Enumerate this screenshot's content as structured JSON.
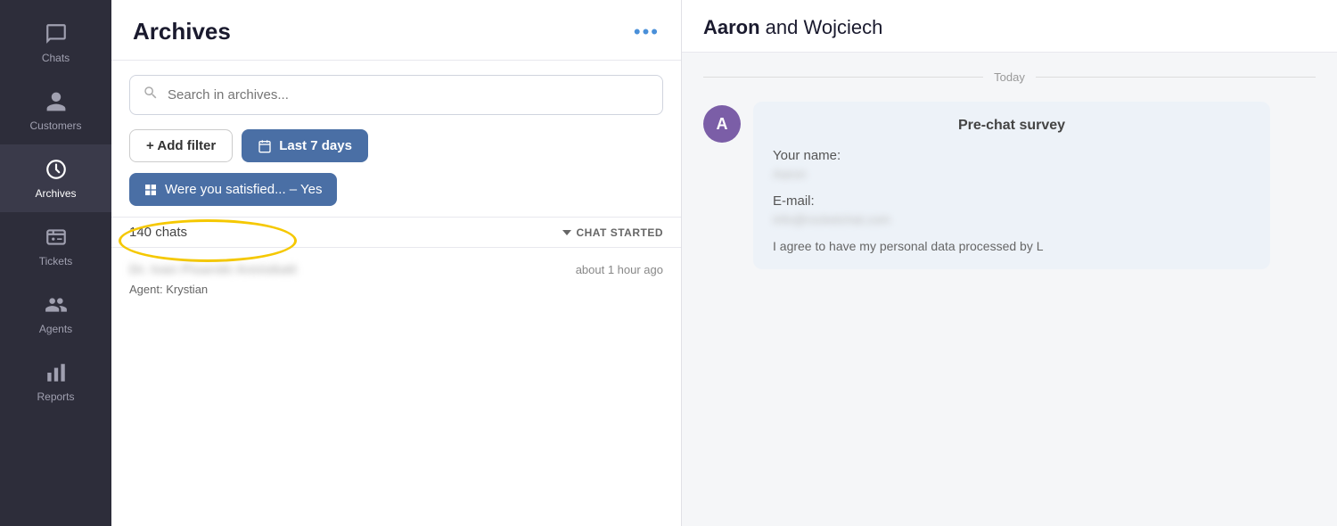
{
  "sidebar": {
    "items": [
      {
        "id": "chats",
        "label": "Chats",
        "icon": "chat-icon",
        "active": false
      },
      {
        "id": "customers",
        "label": "Customers",
        "icon": "customers-icon",
        "active": false
      },
      {
        "id": "archives",
        "label": "Archives",
        "icon": "archives-icon",
        "active": true
      },
      {
        "id": "tickets",
        "label": "Tickets",
        "icon": "tickets-icon",
        "active": false
      },
      {
        "id": "agents",
        "label": "Agents",
        "icon": "agents-icon",
        "active": false
      },
      {
        "id": "reports",
        "label": "Reports",
        "icon": "reports-icon",
        "active": false
      }
    ]
  },
  "archives": {
    "title": "Archives",
    "more_dots": "•••",
    "search_placeholder": "Search in archives...",
    "add_filter_label": "+ Add filter",
    "last7days_label": "Last 7 days",
    "satisfaction_filter": "Were you satisfied... – Yes",
    "chat_count": "140 chats",
    "sort_label": "CHAT STARTED",
    "chat_item": {
      "name": "Dr. Ivan Pisarski Anniskatt",
      "time": "about 1 hour ago",
      "agent": "Agent: Krystian"
    }
  },
  "chat_detail": {
    "header_bold": "Aaron",
    "header_rest": " and Wojciech",
    "date_label": "Today",
    "survey_title": "Pre-chat survey",
    "fields": [
      {
        "label": "Your name:",
        "value": "Aaron"
      },
      {
        "label": "E-mail:",
        "value": "info@rocketchat.com"
      }
    ],
    "consent_text": "I agree to have my personal data processed by L",
    "avatar_letter": "A"
  }
}
